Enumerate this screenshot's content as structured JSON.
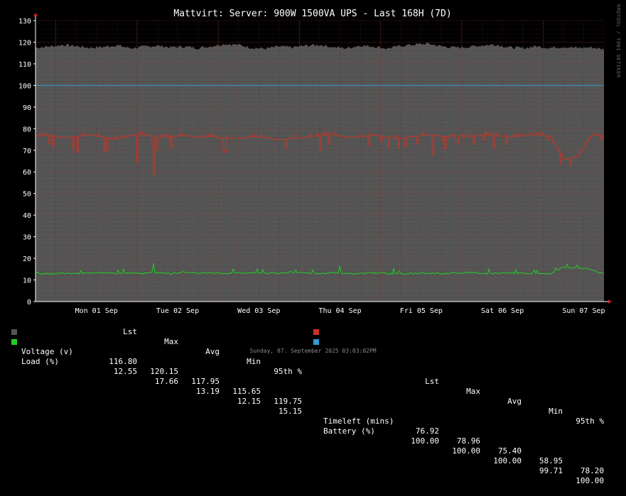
{
  "chart_data": {
    "type": "area",
    "title": "Mattvirt: Server: 900W 1500VA UPS - Last 168H (7D)",
    "ylim": [
      0,
      130
    ],
    "yticks": [
      0,
      10,
      20,
      30,
      40,
      50,
      60,
      70,
      80,
      90,
      100,
      110,
      120,
      130
    ],
    "x_tick_labels": [
      "Mon 01 Sep",
      "Tue 02 Sep",
      "Wed 03 Sep",
      "Thu 04 Sep",
      "Fri 05 Sep",
      "Sat 06 Sep",
      "Sun 07 Sep"
    ],
    "grid": true,
    "series": [
      {
        "name": "Voltage (v)",
        "style": "area",
        "color": "#555555",
        "x": [
          0,
          4,
          8,
          12,
          16,
          20,
          24,
          28,
          32,
          36,
          40,
          44,
          48,
          52,
          56,
          60,
          64,
          68,
          72,
          76,
          80,
          84,
          88,
          92,
          96,
          100,
          104,
          108,
          112,
          116,
          120,
          124,
          128,
          132,
          136,
          140,
          144,
          148,
          152,
          156,
          160,
          164,
          168
        ],
        "values": [
          117.5,
          118.0,
          118.8,
          118.2,
          117.4,
          117.8,
          118.6,
          117.2,
          117.9,
          118.4,
          117.6,
          118.0,
          117.3,
          118.2,
          119.2,
          118.8,
          117.4,
          117.0,
          118.0,
          117.6,
          118.4,
          118.8,
          117.7,
          117.2,
          118.5,
          118.0,
          117.1,
          118.3,
          118.9,
          119.3,
          118.1,
          117.5,
          117.8,
          118.6,
          118.9,
          117.6,
          117.2,
          118.1,
          117.4,
          117.9,
          117.3,
          117.6,
          116.8
        ]
      },
      {
        "name": "Timeleft (mins)",
        "style": "line",
        "color": "#cc3322",
        "x": [
          0,
          4,
          8,
          12,
          16,
          20,
          24,
          28,
          32,
          36,
          40,
          44,
          48,
          52,
          56,
          60,
          64,
          68,
          72,
          76,
          80,
          84,
          88,
          92,
          96,
          100,
          104,
          108,
          112,
          116,
          120,
          124,
          128,
          132,
          136,
          140,
          144,
          148,
          152,
          156,
          160,
          164,
          168
        ],
        "values": [
          76.5,
          77.0,
          75.8,
          76.4,
          77.2,
          76.0,
          75.2,
          76.8,
          77.4,
          75.6,
          76.2,
          76.9,
          75.9,
          76.5,
          75.4,
          75.6,
          76.2,
          75.9,
          74.8,
          75.6,
          76.1,
          76.8,
          77.2,
          75.9,
          76.3,
          77.1,
          76.0,
          75.4,
          76.6,
          77.3,
          76.5,
          75.8,
          76.2,
          77.0,
          76.8,
          75.9,
          76.7,
          77.2,
          76.5,
          65.8,
          67.0,
          76.8,
          76.92
        ],
        "min_points": [
          [
            12,
            69.0
          ],
          [
            20,
            69.5
          ],
          [
            30,
            64.5
          ],
          [
            35,
            58.95
          ],
          [
            40,
            71.0
          ],
          [
            56,
            69.0
          ],
          [
            74,
            71.0
          ],
          [
            84,
            70.0
          ],
          [
            104,
            71.5
          ],
          [
            117,
            68.0
          ],
          [
            158,
            63.0
          ]
        ]
      },
      {
        "name": "Load (%)",
        "style": "line",
        "color": "#22cc22",
        "x": [
          0,
          4,
          8,
          12,
          16,
          20,
          24,
          28,
          32,
          36,
          40,
          44,
          48,
          52,
          56,
          60,
          64,
          68,
          72,
          76,
          80,
          84,
          88,
          92,
          96,
          100,
          104,
          108,
          112,
          116,
          120,
          124,
          128,
          132,
          136,
          140,
          144,
          148,
          152,
          156,
          160,
          164,
          168
        ],
        "values": [
          13.0,
          12.8,
          13.2,
          12.9,
          13.1,
          13.4,
          13.0,
          13.3,
          12.9,
          13.5,
          13.0,
          13.6,
          13.1,
          13.4,
          13.0,
          13.2,
          13.5,
          13.3,
          13.1,
          13.6,
          13.2,
          13.0,
          13.4,
          13.1,
          12.9,
          13.3,
          13.0,
          12.8,
          13.2,
          13.1,
          12.9,
          13.2,
          13.4,
          13.1,
          13.0,
          13.3,
          13.2,
          13.0,
          12.9,
          15.8,
          15.6,
          15.2,
          12.55
        ],
        "max_points": [
          [
            35,
            17.66
          ],
          [
            90,
            16.5
          ],
          [
            106,
            15.5
          ],
          [
            134,
            15.0
          ]
        ]
      },
      {
        "name": "Battery (%)",
        "style": "line",
        "color": "#3399cc",
        "x": [
          0,
          168
        ],
        "values": [
          100.0,
          100.0
        ]
      }
    ]
  },
  "legend": {
    "headers": [
      "Lst",
      "Max",
      "Avg",
      "Min",
      "95th %"
    ],
    "left": [
      {
        "name": "Voltage (v)",
        "color": "#555555",
        "stats": [
          "116.80",
          "120.15",
          "117.95",
          "115.65",
          "119.75"
        ]
      },
      {
        "name": "Load (%)",
        "color": "#22cc22",
        "stats": [
          "12.55",
          "17.66",
          "13.19",
          "12.15",
          "15.15"
        ]
      }
    ],
    "right": [
      {
        "name": "Timeleft (mins)",
        "color": "#cc3322",
        "stats": [
          "76.92",
          "78.96",
          "75.40",
          "58.95",
          "78.20"
        ]
      },
      {
        "name": "Battery (%)",
        "color": "#3399cc",
        "stats": [
          "100.00",
          "100.00",
          "100.00",
          "99.71",
          "100.00"
        ]
      }
    ]
  },
  "timestamp": "Sunday, 07. September 2025 03:03:02PM",
  "side_label": "RRDTOOL / TOBI OETIKER"
}
